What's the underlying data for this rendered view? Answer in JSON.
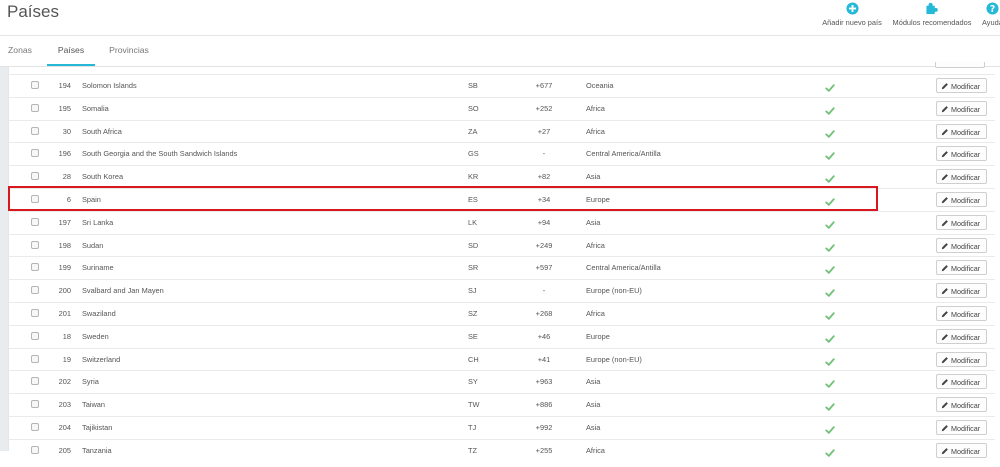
{
  "header": {
    "title": "Países",
    "toolbar": [
      {
        "label": "Añadir nuevo país",
        "icon": "plus-circle-icon"
      },
      {
        "label": "Módulos recomendados",
        "icon": "puzzle-icon"
      },
      {
        "label": "Ayuda",
        "icon": "help-icon"
      }
    ]
  },
  "tabs": [
    {
      "label": "Zonas",
      "active": false
    },
    {
      "label": "Países",
      "active": true
    },
    {
      "label": "Provincias",
      "active": false
    }
  ],
  "colors": {
    "accent": "#25b9d7",
    "check": "#72c279",
    "highlight": "#d7191f"
  },
  "table": {
    "action_label": "Modificar",
    "rows": [
      {
        "id": "194",
        "name": "Solomon Islands",
        "iso": "SB",
        "call_prefix": "+677",
        "zone": "Oceania",
        "enabled": true
      },
      {
        "id": "195",
        "name": "Somalia",
        "iso": "SO",
        "call_prefix": "+252",
        "zone": "Africa",
        "enabled": true
      },
      {
        "id": "30",
        "name": "South Africa",
        "iso": "ZA",
        "call_prefix": "+27",
        "zone": "Africa",
        "enabled": true
      },
      {
        "id": "196",
        "name": "South Georgia and the South Sandwich Islands",
        "iso": "GS",
        "call_prefix": "-",
        "zone": "Central America/Antilla",
        "enabled": true
      },
      {
        "id": "28",
        "name": "South Korea",
        "iso": "KR",
        "call_prefix": "+82",
        "zone": "Asia",
        "enabled": true
      },
      {
        "id": "6",
        "name": "Spain",
        "iso": "ES",
        "call_prefix": "+34",
        "zone": "Europe",
        "enabled": true,
        "highlighted": true
      },
      {
        "id": "197",
        "name": "Sri Lanka",
        "iso": "LK",
        "call_prefix": "+94",
        "zone": "Asia",
        "enabled": true
      },
      {
        "id": "198",
        "name": "Sudan",
        "iso": "SD",
        "call_prefix": "+249",
        "zone": "Africa",
        "enabled": true
      },
      {
        "id": "199",
        "name": "Suriname",
        "iso": "SR",
        "call_prefix": "+597",
        "zone": "Central America/Antilla",
        "enabled": true
      },
      {
        "id": "200",
        "name": "Svalbard and Jan Mayen",
        "iso": "SJ",
        "call_prefix": "-",
        "zone": "Europe (non-EU)",
        "enabled": true
      },
      {
        "id": "201",
        "name": "Swaziland",
        "iso": "SZ",
        "call_prefix": "+268",
        "zone": "Africa",
        "enabled": true
      },
      {
        "id": "18",
        "name": "Sweden",
        "iso": "SE",
        "call_prefix": "+46",
        "zone": "Europe",
        "enabled": true
      },
      {
        "id": "19",
        "name": "Switzerland",
        "iso": "CH",
        "call_prefix": "+41",
        "zone": "Europe (non-EU)",
        "enabled": true
      },
      {
        "id": "202",
        "name": "Syria",
        "iso": "SY",
        "call_prefix": "+963",
        "zone": "Asia",
        "enabled": true
      },
      {
        "id": "203",
        "name": "Taiwan",
        "iso": "TW",
        "call_prefix": "+886",
        "zone": "Asia",
        "enabled": true
      },
      {
        "id": "204",
        "name": "Tajikistan",
        "iso": "TJ",
        "call_prefix": "+992",
        "zone": "Asia",
        "enabled": true
      },
      {
        "id": "205",
        "name": "Tanzania",
        "iso": "TZ",
        "call_prefix": "+255",
        "zone": "Africa",
        "enabled": true
      }
    ]
  }
}
